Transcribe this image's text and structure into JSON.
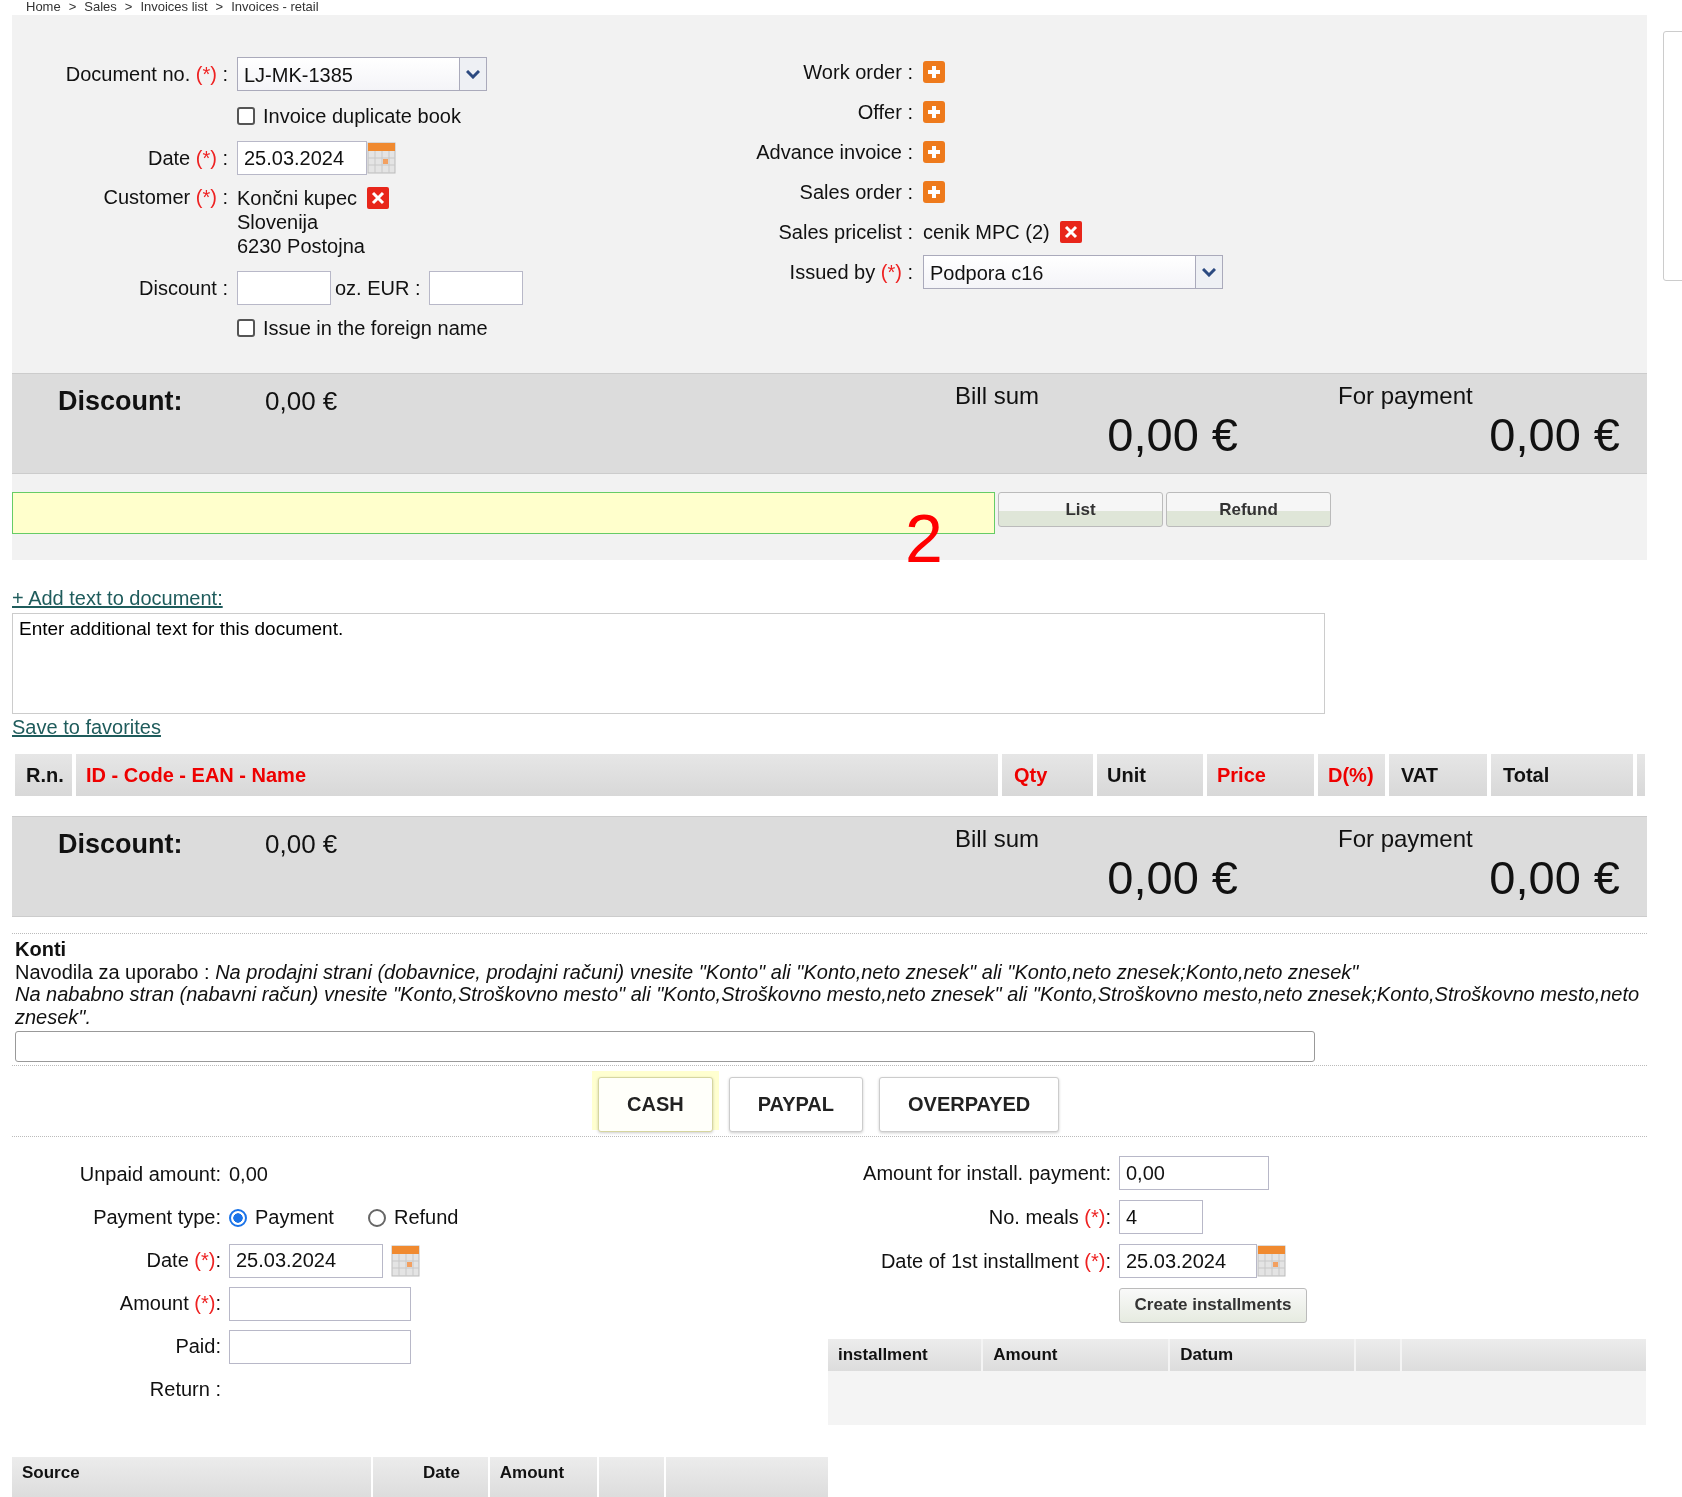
{
  "breadcrumb": {
    "items": [
      "Home",
      "Sales",
      "Invoices list",
      "Invoices - retail"
    ],
    "separator": ">"
  },
  "header_form": {
    "document_no": {
      "label": "Document no.",
      "required": "(*)",
      "colon": " :",
      "value": "LJ-MK-1385"
    },
    "duplicate_book": {
      "label": "Invoice duplicate book",
      "checked": false
    },
    "date": {
      "label": "Date",
      "required": "(*)",
      "colon": " :",
      "value": "25.03.2024"
    },
    "customer": {
      "label": "Customer",
      "required": "(*)",
      "colon": " :",
      "lines": [
        "Končni kupec",
        "Slovenija",
        "6230 Postojna"
      ]
    },
    "discount": {
      "label": "Discount :",
      "eur_label": "oz. EUR :"
    },
    "foreign_name": {
      "label": "Issue in the foreign name",
      "checked": false
    },
    "links": [
      {
        "label": "Work order :"
      },
      {
        "label": "Offer :"
      },
      {
        "label": "Advance invoice :"
      },
      {
        "label": "Sales order :"
      }
    ],
    "pricelist": {
      "label": "Sales pricelist :",
      "value": "cenik MPC (2)"
    },
    "issued_by": {
      "label": "Issued by",
      "required": "(*)",
      "colon": " :",
      "value": "Podpora c16"
    }
  },
  "totals_top": {
    "discount_label": "Discount:",
    "discount_value": "0,00 €",
    "bill_sum_label": "Bill sum",
    "bill_sum": "0,00 €",
    "for_payment_label": "For payment",
    "for_payment": "0,00 €"
  },
  "search_row": {
    "buttons": [
      "List",
      "Refund"
    ],
    "annotation": "2"
  },
  "add_text_link": "+ Add text to document:",
  "document_text": {
    "value": "Enter additional text for this document."
  },
  "save_favorites_link": "Save to favorites",
  "items_table": {
    "columns": [
      {
        "label": "R.n.",
        "required": false
      },
      {
        "label": "ID - Code - EAN - Name",
        "required": true
      },
      {
        "label": "Qty",
        "required": true
      },
      {
        "label": "Unit",
        "required": false
      },
      {
        "label": "Price",
        "required": true
      },
      {
        "label": "D(%)",
        "required": true
      },
      {
        "label": "VAT",
        "required": false
      },
      {
        "label": "Total",
        "required": false
      }
    ]
  },
  "totals_bottom": {
    "discount_label": "Discount:",
    "discount_value": "0,00 €",
    "bill_sum_label": "Bill sum",
    "bill_sum": "0,00 €",
    "for_payment_label": "For payment",
    "for_payment": "0,00 €"
  },
  "konti": {
    "title": "Konti",
    "instruction_line_1": "Navodila za uporabo : *Na prodajni strani (dobavnice, prodajni računi) vnesite \"Konto\" ali \"Konto,neto znesek\" ali \"Konto,neto znesek;Konto,neto znesek\"*",
    "instruction_line_2": "Na nababno stran (nabavni račun) vnesite \"Konto,Stroškovno mesto\" ali \"Konto,Stroškovno mesto,neto znesek\" ali \"Konto,Stroškovno mesto,neto znesek;Konto,Stroškovno mesto,neto znesek\"."
  },
  "payment_buttons": [
    {
      "label": "CASH",
      "selected": true
    },
    {
      "label": "PAYPAL",
      "selected": false
    },
    {
      "label": "OVERPAYED",
      "selected": false
    }
  ],
  "payment_form": {
    "unpaid": {
      "label": "Unpaid amount:",
      "value": "0,00"
    },
    "payment_type": {
      "label": "Payment type:",
      "options": [
        {
          "label": "Payment",
          "selected": true
        },
        {
          "label": "Refund",
          "selected": false
        }
      ]
    },
    "date": {
      "label": "Date",
      "required": "(*)",
      "colon": ":",
      "value": "25.03.2024"
    },
    "amount": {
      "label": "Amount",
      "required": "(*)",
      "colon": ":"
    },
    "paid": {
      "label": "Paid:"
    },
    "return": {
      "label": "Return :"
    }
  },
  "installments_form": {
    "amount": {
      "label": "Amount for install. payment:",
      "value": "0,00"
    },
    "meals": {
      "label": "No. meals",
      "required": "(*)",
      "colon": ":",
      "value": "4"
    },
    "first_date": {
      "label": "Date of 1st installment",
      "required": "(*)",
      "colon": ":",
      "value": "25.03.2024"
    },
    "button": "Create installments"
  },
  "installments_table": {
    "columns": [
      "installment",
      "Amount",
      "Datum"
    ]
  },
  "source_table": {
    "columns": [
      "Source",
      "Date",
      "Amount"
    ]
  }
}
